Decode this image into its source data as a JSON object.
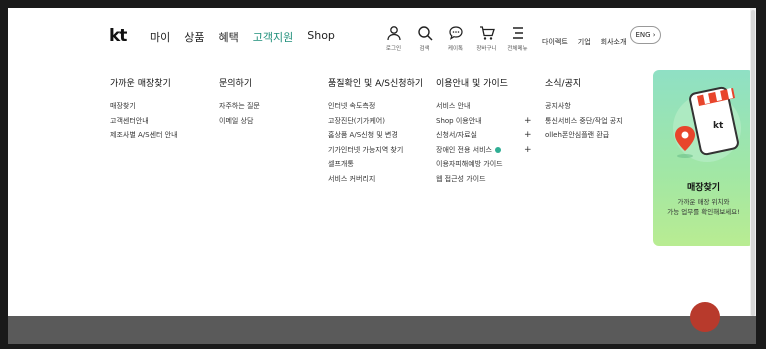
{
  "header": {
    "logo": "kt",
    "nav": [
      {
        "label": "마이",
        "active": false
      },
      {
        "label": "상품",
        "active": false
      },
      {
        "label": "혜택",
        "active": false
      },
      {
        "label": "고객지원",
        "active": true
      },
      {
        "label": "Shop",
        "active": false
      }
    ],
    "util_icons": [
      {
        "label": "로그인",
        "icon": "person-icon"
      },
      {
        "label": "검색",
        "icon": "search-icon"
      },
      {
        "label": "케이톡",
        "icon": "chat-icon"
      },
      {
        "label": "장바구니",
        "icon": "cart-icon"
      },
      {
        "label": "전체메뉴",
        "icon": "menu-icon"
      }
    ],
    "top_links": [
      "다이렉트",
      "기업",
      "회사소개"
    ],
    "lang": "ENG ›"
  },
  "menu": {
    "columns": [
      {
        "title": "가까운 매장찾기",
        "links": [
          {
            "label": "매장찾기"
          },
          {
            "label": "고객센터안내"
          },
          {
            "label": "제조사별 A/S센터 안내"
          }
        ]
      },
      {
        "title": "문의하기",
        "links": [
          {
            "label": "자주하는 질문"
          },
          {
            "label": "이메일 상담"
          }
        ]
      },
      {
        "title": "품질확인 및 A/S신청하기",
        "links": [
          {
            "label": "인터넷 속도측정"
          },
          {
            "label": "고장진단(기가케어)"
          },
          {
            "label": "홈상품 A/S신청 및 변경"
          },
          {
            "label": "기가인터넷 가능지역 찾기"
          },
          {
            "label": "셀프개통"
          },
          {
            "label": "서비스 커버리지"
          }
        ]
      },
      {
        "title": "이용안내 및 가이드",
        "links": [
          {
            "label": "서비스 안내",
            "plus": ""
          },
          {
            "label": "Shop 이용안내",
            "plus": "+"
          },
          {
            "label": "신청서/자료실",
            "plus": "+"
          },
          {
            "label": "장애인 전용 서비스",
            "plus": "+",
            "badge": true
          },
          {
            "label": "이용자피해예방 가이드",
            "plus": ""
          },
          {
            "label": "웹 접근성 가이드",
            "plus": ""
          }
        ]
      },
      {
        "title": "소식/공지",
        "links": [
          {
            "label": "공지사항"
          },
          {
            "label": "통신서비스 중단/작업 공지"
          },
          {
            "label": "olleh폰안심플랜 환급"
          }
        ]
      }
    ]
  },
  "store_card": {
    "title": "매장찾기",
    "desc": "가까운 매장 위치와\n가능 업무를 확인해보세요!",
    "colors": {
      "top": "#8fe0c4",
      "bottom": "#b9ec92",
      "pin": "#e8452c"
    }
  }
}
